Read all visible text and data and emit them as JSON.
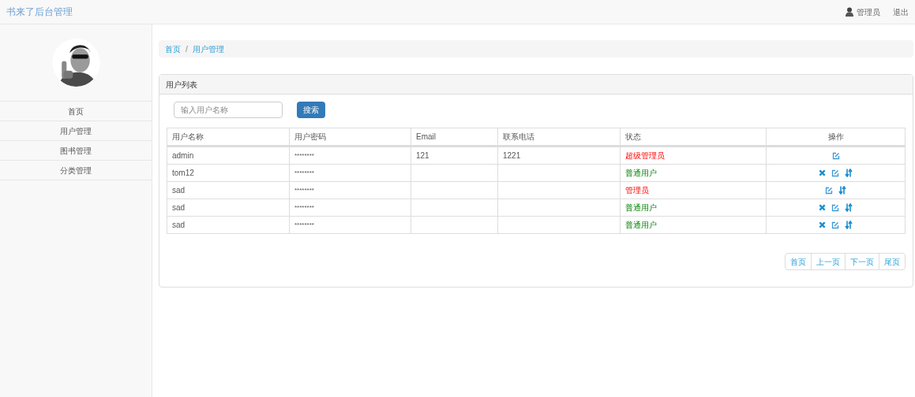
{
  "navbar": {
    "brand": "书来了后台管理",
    "user": "管理员",
    "logout": "退出"
  },
  "sidebar": {
    "items": [
      {
        "label": "首页"
      },
      {
        "label": "用户管理"
      },
      {
        "label": "图书管理"
      },
      {
        "label": "分类管理"
      }
    ]
  },
  "breadcrumb": {
    "separator": "/",
    "items": [
      "首页",
      "用户管理"
    ]
  },
  "panel": {
    "title": "用户列表",
    "search": {
      "placeholder": "输入用户名称",
      "button": "搜索"
    },
    "table": {
      "columns": [
        "用户名称",
        "用户密码",
        "Email",
        "联系电话",
        "状态",
        "操作"
      ],
      "rows": [
        {
          "name": "admin",
          "password": "********",
          "email": "121",
          "phone": "1221",
          "status": "超级管理员",
          "kind": "admin",
          "deletable": false,
          "sortable": false
        },
        {
          "name": "tom12",
          "password": "********",
          "email": "",
          "phone": "",
          "status": "普通用户",
          "kind": "user",
          "deletable": true,
          "sortable": true
        },
        {
          "name": "sad",
          "password": "********",
          "email": "",
          "phone": "",
          "status": "管理员",
          "kind": "admin",
          "deletable": false,
          "sortable": true
        },
        {
          "name": "sad",
          "password": "********",
          "email": "",
          "phone": "",
          "status": "普通用户",
          "kind": "user",
          "deletable": true,
          "sortable": true
        },
        {
          "name": "sad",
          "password": "********",
          "email": "",
          "phone": "",
          "status": "普通用户",
          "kind": "user",
          "deletable": true,
          "sortable": true
        }
      ]
    },
    "pagination": [
      "首页",
      "上一页",
      "下一页",
      "尾页"
    ]
  }
}
